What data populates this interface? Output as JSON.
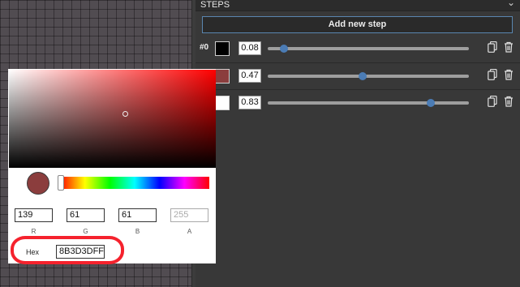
{
  "panel": {
    "header": "STEPS",
    "add_button": "Add new step",
    "steps": [
      {
        "label": "#0",
        "color": "#000000",
        "position": "0.08",
        "slider": 0.08
      },
      {
        "label": "",
        "color": "#8B3D3D",
        "position": "0.47",
        "slider": 0.47
      },
      {
        "label": "",
        "color": "#FFFFFF",
        "position": "0.83",
        "slider": 0.83
      }
    ]
  },
  "picker": {
    "current_color": "#8B3D3D",
    "hue_color": "#FF0000",
    "r": "139",
    "g": "61",
    "b": "61",
    "a": "255",
    "r_label": "R",
    "g_label": "G",
    "b_label": "B",
    "a_label": "A",
    "hex_label": "Hex",
    "hex_value": "8B3D3DFF"
  },
  "annotation_color": "#F5222D"
}
